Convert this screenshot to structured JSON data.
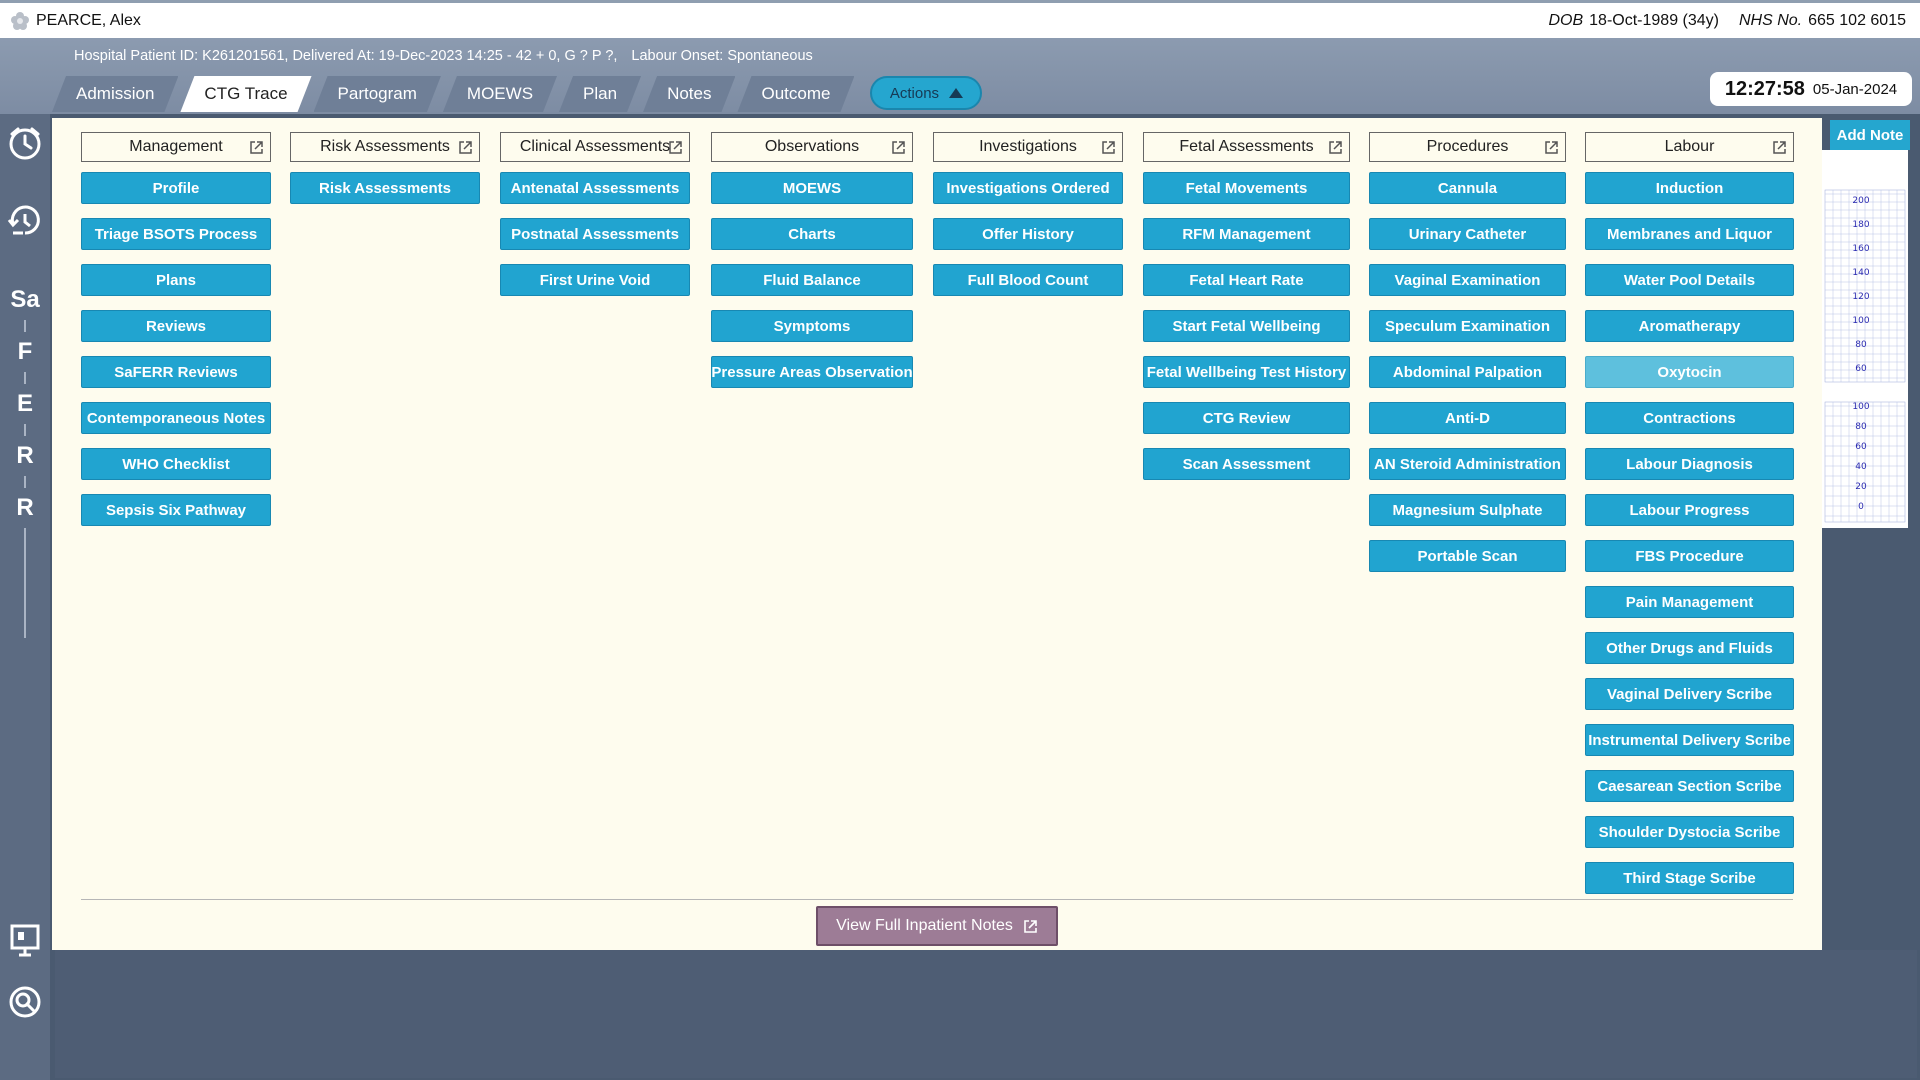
{
  "patient": {
    "name": "PEARCE, Alex",
    "dob_label": "DOB",
    "dob_value": "18-Oct-1989 (34y)",
    "nhs_label": "NHS No.",
    "nhs_value": "665 102 6015"
  },
  "header": {
    "hospital_info": "Hospital Patient ID: K261201561, Delivered At: 19-Dec-2023 14:25 - 42 + 0, G ? P ?,",
    "labour_onset": "Labour Onset: Spontaneous",
    "tabs": [
      {
        "label": "Admission"
      },
      {
        "label": "CTG Trace"
      },
      {
        "label": "Partogram"
      },
      {
        "label": "MOEWS"
      },
      {
        "label": "Plan"
      },
      {
        "label": "Notes"
      },
      {
        "label": "Outcome"
      }
    ],
    "actions_label": "Actions",
    "time": "12:27:58",
    "date": "05-Jan-2024"
  },
  "rail": {
    "letters": [
      "Sa",
      "F",
      "E",
      "R",
      "R"
    ]
  },
  "add_note_label": "Add Note",
  "ctg": {
    "upper_ticks": [
      "200",
      "180",
      "160",
      "140",
      "120",
      "100",
      "80",
      "60"
    ],
    "lower_ticks": [
      "100",
      "80",
      "60",
      "40",
      "20",
      "0"
    ]
  },
  "columns": [
    {
      "title": "Management",
      "buttons": [
        "Profile",
        "Triage BSOTS Process",
        "Plans",
        "Reviews",
        "SaFERR Reviews",
        "Contemporaneous Notes",
        "WHO Checklist",
        "Sepsis Six Pathway"
      ]
    },
    {
      "title": "Risk Assessments",
      "buttons": [
        "Risk Assessments"
      ]
    },
    {
      "title": "Clinical Assessments",
      "buttons": [
        "Antenatal Assessments",
        "Postnatal Assessments",
        "First Urine Void"
      ]
    },
    {
      "title": "Observations",
      "buttons": [
        "MOEWS",
        "Charts",
        "Fluid Balance",
        "Symptoms",
        "Pressure Areas Observation"
      ]
    },
    {
      "title": "Investigations",
      "buttons": [
        "Investigations Ordered",
        "Offer History",
        "Full Blood Count"
      ]
    },
    {
      "title": "Fetal Assessments",
      "buttons": [
        "Fetal Movements",
        "RFM Management",
        "Fetal Heart Rate",
        "Start Fetal Wellbeing",
        "Fetal Wellbeing Test History",
        "CTG Review",
        "Scan Assessment"
      ]
    },
    {
      "title": "Procedures",
      "buttons": [
        "Cannula",
        "Urinary Catheter",
        "Vaginal Examination",
        "Speculum Examination",
        "Abdominal Palpation",
        "Anti-D",
        "AN Steroid Administration",
        "Magnesium Sulphate",
        "Portable Scan"
      ]
    },
    {
      "title": "Labour",
      "buttons": [
        "Induction",
        "Membranes and Liquor",
        "Water Pool Details",
        "Aromatherapy",
        "Oxytocin",
        "Contractions",
        "Labour Diagnosis",
        "Labour Progress",
        "FBS Procedure",
        "Pain Management",
        "Other Drugs and Fluids",
        "Vaginal Delivery Scribe",
        "Instrumental Delivery Scribe",
        "Caesarean Section Scribe",
        "Shoulder Dystocia Scribe",
        "Third Stage Scribe"
      ]
    }
  ],
  "view_notes_label": "View Full Inpatient Notes",
  "colors": {
    "button": "#21a4d0",
    "button_muted": "#5ec0dd",
    "panel_bg": "#fefcee",
    "header_band": "#8c9bb0",
    "view_notes": "#9d7c96"
  }
}
